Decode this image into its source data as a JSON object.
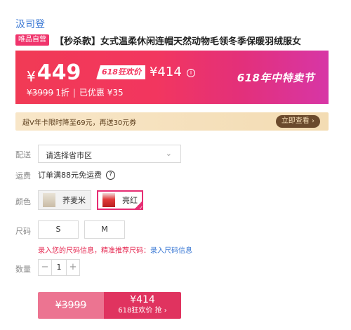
{
  "brand": "汲司登",
  "product": {
    "badge": "唯品自营",
    "title": "【秒杀款】女式温柔休闲连帽天然动物毛领冬季保暖羽绒服女"
  },
  "price": {
    "symbol": "¥",
    "current": "449",
    "promo_label": "618狂欢价",
    "promo_price": "¥414",
    "info_icon": "info-icon",
    "original": "¥3999",
    "discount": "1折",
    "separator": "|",
    "saved": "已优惠 ¥35",
    "festival": "618年中特卖节",
    "banner_gradient": [
      "#f13a55",
      "#d736a6"
    ]
  },
  "vip": {
    "text": "超V年卡限时降至69元，再送30元券",
    "button": "立即查看 ›"
  },
  "delivery": {
    "label": "配送",
    "placeholder": "请选择省市区",
    "arrow_icon": "chevron-down-icon"
  },
  "shipping": {
    "label": "运费",
    "text": "订单满88元免运费",
    "help_icon": "question-icon"
  },
  "color": {
    "label": "颜色",
    "options": [
      {
        "name": "荞麦米",
        "selected": false
      },
      {
        "name": "亮红",
        "selected": true
      }
    ],
    "accent": "#e62d73"
  },
  "size": {
    "label": "尺码",
    "options": [
      "S",
      "M"
    ],
    "tip": "录入您的尺码信息，精准推荐尺码：",
    "tip_link": "录入尺码信息"
  },
  "quantity": {
    "label": "数量",
    "minus": "−",
    "value": "1",
    "plus": "+"
  },
  "buy": {
    "original": "¥3999",
    "price": "¥414",
    "sub": "618狂欢价 抢 ›"
  }
}
